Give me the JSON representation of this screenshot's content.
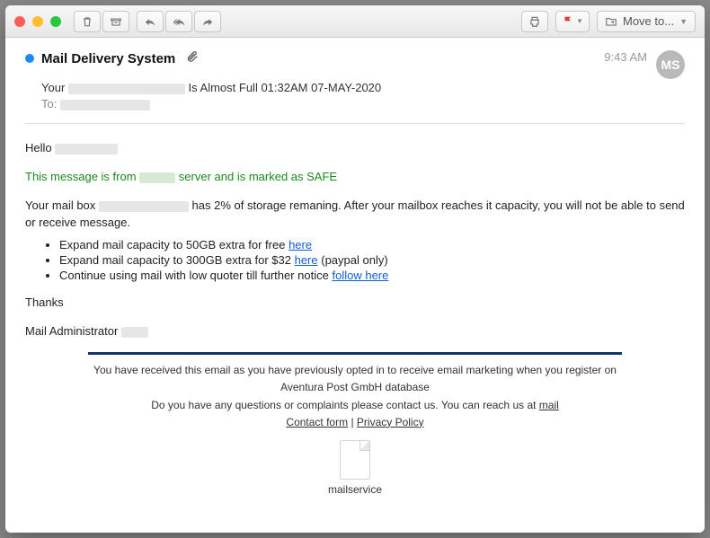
{
  "toolbar": {
    "moveTo": "Move to..."
  },
  "header": {
    "sender": "Mail Delivery System",
    "time": "9:43 AM",
    "avatar": "MS",
    "subject_prefix": "Your",
    "subject_suffix": "Is Almost Full 01:32AM  07-MAY-2020",
    "to_label": "To:"
  },
  "body": {
    "hello": "Hello",
    "safe_pre": "This message is from",
    "safe_post": "server and is marked as SAFE",
    "storage_pre": "Your mail box",
    "storage_post": "has 2% of storage remaning. After your mailbox reaches it capacity, you will not be able to send or receive message.",
    "li1_pre": "Expand mail capacity to 50GB extra for free ",
    "li1_link": "here",
    "li2_pre": "Expand mail capacity to 300GB extra for $32 ",
    "li2_link": "here",
    "li2_post": " (paypal only)",
    "li3_pre": "Continue using mail with low quoter till further notice ",
    "li3_link": "follow here",
    "thanks": "Thanks",
    "sig": "Mail Administrator"
  },
  "footer": {
    "line1": "You have received this email as you have previously opted in to receive email marketing when you register on",
    "line2": "Aventura Post GmbH database",
    "line3_pre": "Do you have any questions or complaints please contact us. You can reach us at ",
    "line3_link": "mail",
    "contact": "Contact form",
    "sep": " | ",
    "privacy": "Privacy Policy"
  },
  "attachment": {
    "name": "mailservice"
  }
}
